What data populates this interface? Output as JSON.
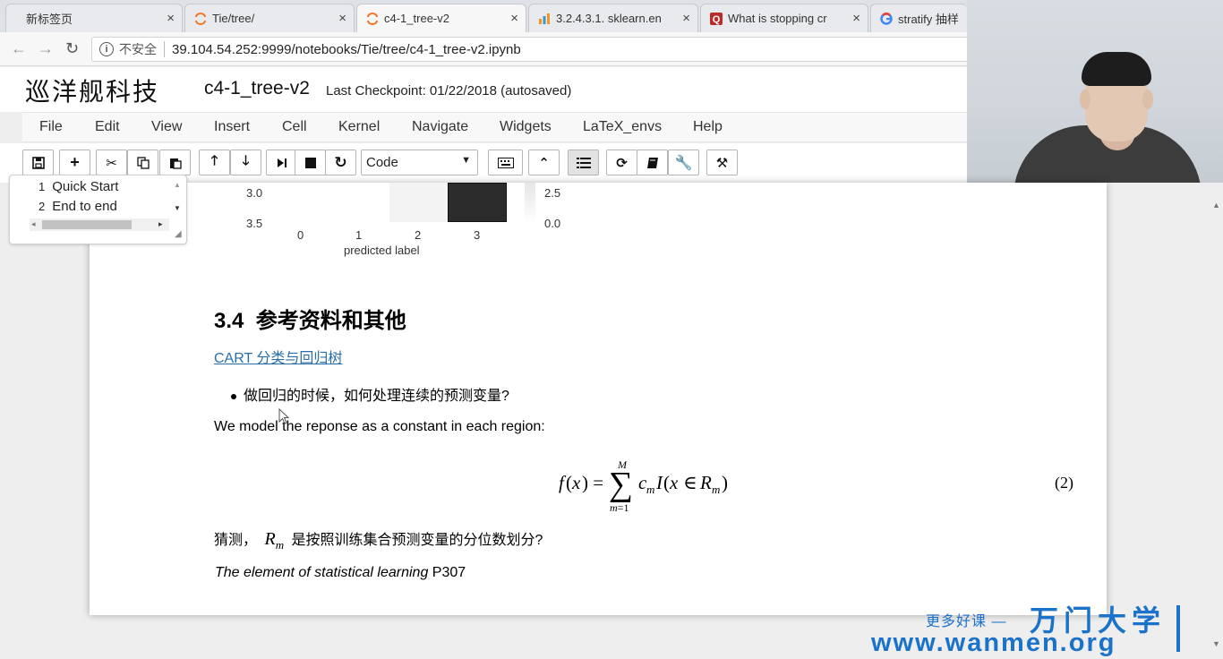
{
  "browser": {
    "tabs": [
      {
        "label": "新标签页",
        "close": "×"
      },
      {
        "label": "Tie/tree/",
        "close": "×"
      },
      {
        "label": "c4-1_tree-v2",
        "close": "×"
      },
      {
        "label": "3.2.4.3.1. sklearn.en",
        "close": "×"
      },
      {
        "label": "What is stopping cr",
        "close": "×"
      },
      {
        "label": "stratify 抽样",
        "close": ""
      }
    ],
    "insecure_label": "不安全",
    "url": "39.104.54.252:9999/notebooks/Tie/tree/c4-1_tree-v2.ipynb"
  },
  "jupyter": {
    "logo": "巡洋舰科技",
    "notebook_title": "c4-1_tree-v2",
    "checkpoint": "Last Checkpoint: 01/22/2018 (autosaved)",
    "menu": [
      "File",
      "Edit",
      "View",
      "Insert",
      "Cell",
      "Kernel",
      "Navigate",
      "Widgets",
      "LaTeX_envs",
      "Help"
    ],
    "cell_type": "Code"
  },
  "toc": {
    "items": [
      {
        "num": "1",
        "label": "Quick Start"
      },
      {
        "num": "2",
        "label": "End to end"
      }
    ]
  },
  "chart_data": {
    "type": "heatmap",
    "xlabel": "predicted label",
    "x_ticks": [
      "0",
      "1",
      "2",
      "3"
    ],
    "y_ticks": [
      "3.0",
      "3.5"
    ],
    "colorbar_ticks": [
      "2.5",
      "0.0"
    ]
  },
  "content": {
    "heading_num": "3.4",
    "heading_text": "参考资料和其他",
    "link_text": "CART 分类与回归树",
    "bullet": "做回归的时候，如何处理连续的预测变量?",
    "para1": "We model the reponse as a constant in each region:",
    "equation_number": "(2)",
    "para2_prefix": "猜测，",
    "para2_suffix": "是按照训练集合预测变量的分位数划分?",
    "para3_italic": "The element of statistical learning",
    "para3_tail": " P307"
  },
  "watermark": {
    "line1": "更多好课 —",
    "brand": "万门大学",
    "line2": "www.wanmen.org"
  }
}
